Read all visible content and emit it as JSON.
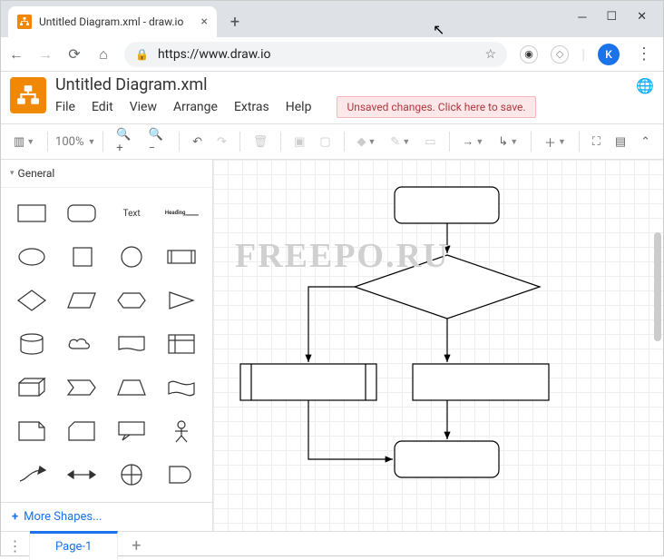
{
  "browser": {
    "tab_title": "Untitled Diagram.xml - draw.io",
    "url": "https://www.draw.io",
    "user_initial": "K"
  },
  "app": {
    "title": "Untitled Diagram.xml",
    "menus": [
      "File",
      "Edit",
      "View",
      "Arrange",
      "Extras",
      "Help"
    ],
    "unsaved_message": "Unsaved changes. Click here to save.",
    "zoom": "100%"
  },
  "sidebar": {
    "palette_name": "General",
    "text_label": "Text",
    "heading_label": "Heading",
    "more_shapes": "More Shapes..."
  },
  "canvas": {
    "watermark": "FREEPO.RU"
  },
  "pages": {
    "active": "Page-1"
  }
}
